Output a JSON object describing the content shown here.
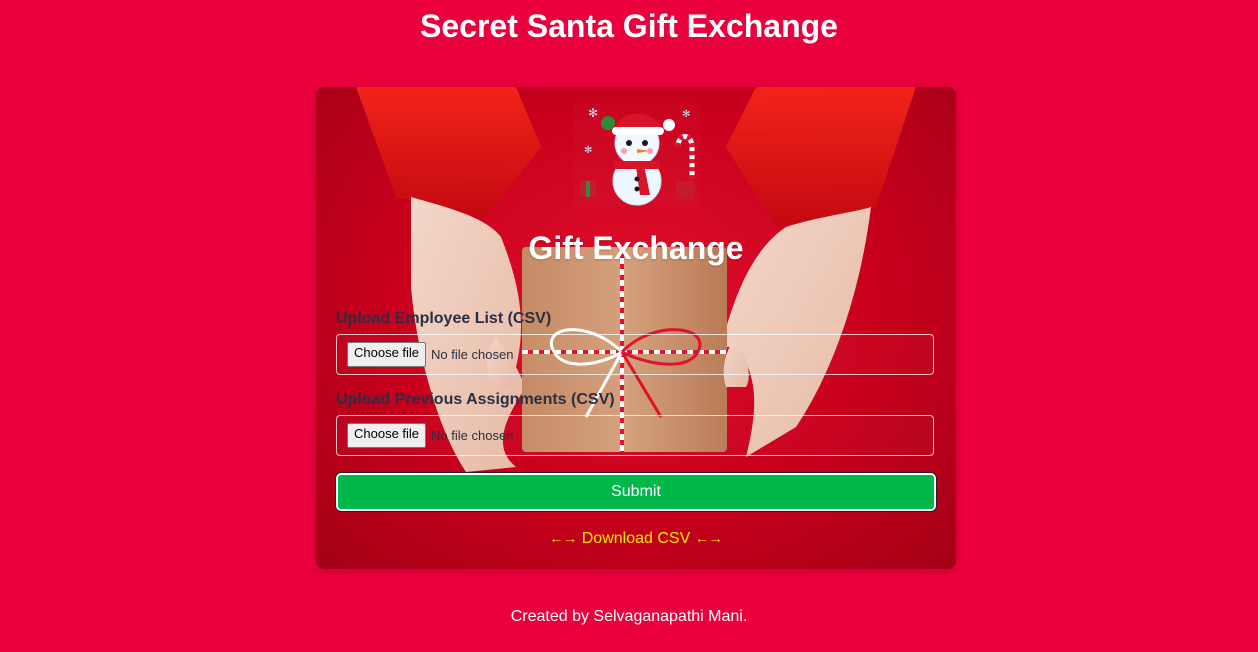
{
  "header": {
    "title": "Secret Santa Gift Exchange"
  },
  "card": {
    "heading": "Gift Exchange",
    "employee_upload": {
      "label": "Upload Employee List (CSV)",
      "button_label": "Choose file",
      "status": "No file chosen"
    },
    "previous_upload": {
      "label": "Upload Previous Assignments (CSV)",
      "button_label": "Choose file",
      "status": "No file chosen"
    },
    "submit_label": "Submit",
    "download": {
      "left_arrows": "←→",
      "label": "Download CSV",
      "right_arrows": "←→"
    }
  },
  "footer": {
    "text": "Created by Selvaganapathi Mani."
  },
  "colors": {
    "page_background": "#ea003c",
    "submit_green": "#00b74a",
    "link_yellow": "#ffeb00",
    "label_dark": "#2a2f45"
  },
  "icons": {
    "mascot": "snowman-icon"
  }
}
